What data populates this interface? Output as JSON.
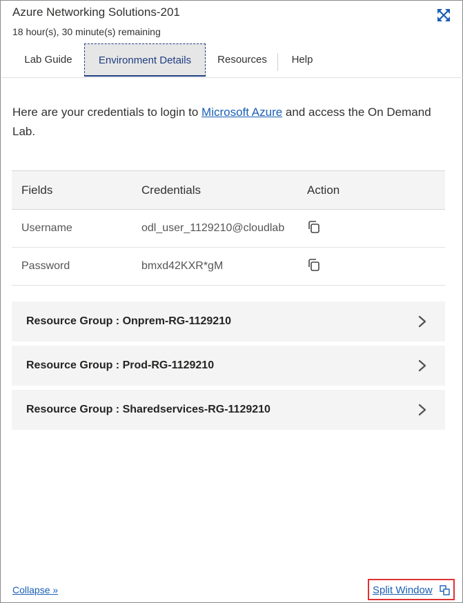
{
  "header": {
    "title": "Azure Networking Solutions-201",
    "time_remaining": "18 hour(s), 30 minute(s) remaining",
    "expand_icon": "expand-arrows-icon"
  },
  "tabs": [
    {
      "label": "Lab Guide",
      "active": false
    },
    {
      "label": "Environment Details",
      "active": true
    },
    {
      "label": "Resources",
      "active": false
    },
    {
      "label": "Help",
      "active": false
    }
  ],
  "intro": {
    "before_link": "Here are your credentials to login to ",
    "link_text": "Microsoft Azure",
    "after_link": " and access the On Demand Lab."
  },
  "credentials_table": {
    "headers": [
      "Fields",
      "Credentials",
      "Action"
    ],
    "rows": [
      {
        "field": "Username",
        "value": "odl_user_1129210@cloudlab",
        "action_icon": "copy-icon"
      },
      {
        "field": "Password",
        "value": "bmxd42KXR*gM",
        "action_icon": "copy-icon"
      }
    ]
  },
  "resource_groups": [
    {
      "label": "Resource Group : Onprem-RG-1129210"
    },
    {
      "label": "Resource Group : Prod-RG-1129210"
    },
    {
      "label": "Resource Group : Sharedservices-RG-1129210"
    }
  ],
  "footer": {
    "collapse_label": "Collapse »",
    "split_label": "Split Window",
    "split_icon": "split-window-icon"
  },
  "colors": {
    "link": "#1a5fb4",
    "active_tab_border": "#1f3d80",
    "highlight_box": "#e03131",
    "panel_bg": "#f4f4f4"
  }
}
